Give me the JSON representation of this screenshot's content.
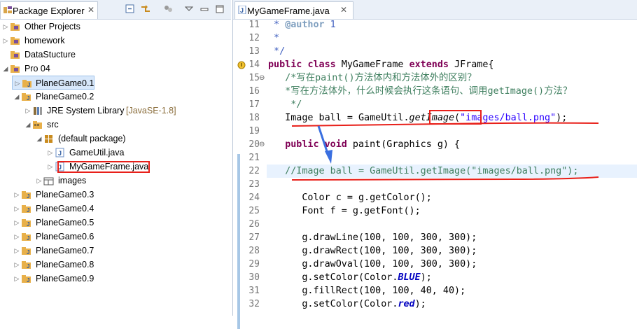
{
  "explorer": {
    "tab_title": "Package Explorer",
    "tab_close": "✕",
    "tree": [
      {
        "label": "Other Projects",
        "decoration": ""
      },
      {
        "label": "homework",
        "decoration": ""
      },
      {
        "label": "DataStucture",
        "decoration": ""
      },
      {
        "label": "Pro 04",
        "decoration": ""
      },
      {
        "label": "PlaneGame0.1",
        "decoration": ""
      },
      {
        "label": "PlaneGame0.2",
        "decoration": ""
      },
      {
        "label": "JRE System Library",
        "decoration": "[JavaSE-1.8]"
      },
      {
        "label": "src",
        "decoration": ""
      },
      {
        "label": "(default package)",
        "decoration": ""
      },
      {
        "label": "GameUtil.java",
        "decoration": ""
      },
      {
        "label": "MyGameFrame.java",
        "decoration": ""
      },
      {
        "label": "images",
        "decoration": ""
      },
      {
        "label": "PlaneGame0.3",
        "decoration": ""
      },
      {
        "label": "PlaneGame0.4",
        "decoration": ""
      },
      {
        "label": "PlaneGame0.5",
        "decoration": ""
      },
      {
        "label": "PlaneGame0.6",
        "decoration": ""
      },
      {
        "label": "PlaneGame0.7",
        "decoration": ""
      },
      {
        "label": "PlaneGame0.8",
        "decoration": ""
      },
      {
        "label": "PlaneGame0.9",
        "decoration": ""
      }
    ]
  },
  "editor": {
    "tab_title": "MyGameFrame.java",
    "tab_close": "✕",
    "line_numbers": [
      "11",
      "12",
      "13",
      "14",
      "15",
      "16",
      "17",
      "18",
      "19",
      "20",
      "21",
      "22",
      "23",
      "24",
      "25",
      "26",
      "27",
      "28",
      "29",
      "30",
      "31",
      "32"
    ],
    "lines": {
      "l11a": " * ",
      "l11b": "@author",
      "l11c": " 1",
      "l12": " *",
      "l13": " */",
      "l14a": "public",
      "l14b": " ",
      "l14c": "class",
      "l14d": " MyGameFrame ",
      "l14e": "extends",
      "l14f": " JFrame{",
      "l15": "   /*写在paint()方法体内和方法体外的区别？",
      "l16": "   *写在方法体外，什么时候会执行这条语句、调用getImage()方法？",
      "l17": "    */",
      "l18a": "   Image ball = GameUtil.",
      "l18b": "getImage",
      "l18c": "(",
      "l18d": "\"images/ball.png\"",
      "l18e": ");",
      "l19": "",
      "l20a": "   ",
      "l20b": "public",
      "l20c": " ",
      "l20d": "void",
      "l20e": " paint(Graphics g) {",
      "l21": "",
      "l22": "   //Image ball = GameUtil.getImage(\"images/ball.png\");",
      "l23": "",
      "l24": "      Color c = g.getColor();",
      "l25": "      Font f = g.getFont();",
      "l26": "",
      "l27": "      g.drawLine(100, 100, 300, 300);",
      "l28": "      g.drawRect(100, 100, 300, 300);",
      "l29": "      g.drawOval(100, 100, 300, 300);",
      "l30a": "      g.setColor(Color.",
      "l30b": "BLUE",
      "l30c": ");",
      "l31": "      g.fillRect(100, 100, 40, 40);",
      "l32a": "      g.setColor(Color.",
      "l32b": "red",
      "l32c": ");"
    },
    "fold_markers": [
      "⊖",
      "⊖"
    ]
  },
  "colors": {
    "keyword": "#7f0055",
    "comment": "#3f7f5f",
    "javadoc": "#3f5fbf",
    "string": "#2a00ff",
    "annotation_red": "#e8201a",
    "arrow_blue": "#3a6fe0",
    "selection": "#d8e8fb"
  },
  "icons": [
    "package-explorer-icon",
    "collapse-all-icon",
    "link-with-editor-icon",
    "view-menu-icon",
    "minimize-icon",
    "maximize-icon",
    "java-file-icon",
    "project-folder-icon",
    "package-icon",
    "library-icon",
    "source-folder-icon",
    "java-class-icon"
  ]
}
